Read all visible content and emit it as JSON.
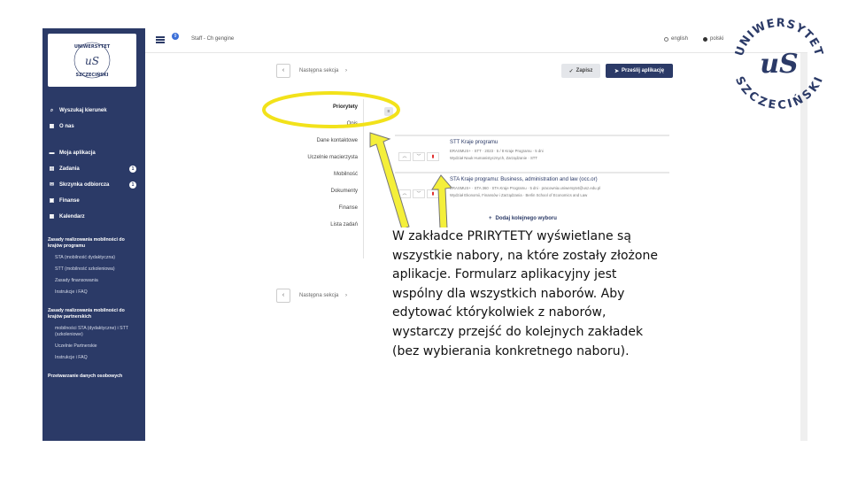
{
  "topbar": {
    "title": "Staff - Ch gengine",
    "badge": "9",
    "lang_en": "english",
    "lang_pl": "polski"
  },
  "sidebar": {
    "logo_text": "UNIWERSYTET SZCZECIŃSKI",
    "items": [
      {
        "icon": "search-icon",
        "label": "Wyszukaj kierunek",
        "badge": ""
      },
      {
        "icon": "bank-icon",
        "label": "O nas",
        "badge": ""
      },
      {
        "icon": "folder-icon",
        "label": "Moja aplikacja",
        "badge": ""
      },
      {
        "icon": "clipboard-icon",
        "label": "Zadania",
        "badge": "1"
      },
      {
        "icon": "mail-icon",
        "label": "Skrzynka odbiorcza",
        "badge": "1"
      },
      {
        "icon": "finance-icon",
        "label": "Finanse",
        "badge": ""
      },
      {
        "icon": "calendar-icon",
        "label": "Kalendarz",
        "badge": ""
      }
    ],
    "section1_title": "Zasady realizowania mobilności do krajów programu",
    "section1_items": [
      "STA (mobilność dydaktyczna)",
      "STT (mobilność szkoleniowa)",
      "Zasady finansowania",
      "Instrukcje i FAQ"
    ],
    "section2_title": "Zasady realizowania mobilności do krajów partnerskich",
    "section2_items": [
      "mobilności STA (dydaktyczne) i STT (szkoleniowe)",
      "Uczelnie Partnerskie",
      "Instrukcje i FAQ"
    ],
    "section3_title": "Przetwarzanie danych osobowych"
  },
  "main": {
    "prev_section": "Następna sekcja",
    "save_label": "Zapisz",
    "send_label": "Prześlij aplikację",
    "tabs": [
      "Priorytety",
      "Opis",
      "Dane kontaktowe",
      "Uczelnie macierzysta",
      "Mobilność",
      "Dokumenty",
      "Finanse",
      "Lista zadań"
    ],
    "collapse_label": "≡",
    "cards": [
      {
        "title": "STT Kraje programu",
        "meta1": "ERASMUS+ · STT · 2023 · 5 / 8 Kraje Programu · 5 dni",
        "meta2": "Wydział Nauk Humanistycznych, Zarządzanie · STT"
      },
      {
        "title": "STA Kraje programu: Business, administration and law (occ.or)",
        "meta1": "ERASMUS+ · STA 360 · STA Kraje Programu · 5 dni · pracownia.uniwersytet@usz.edu.pl",
        "meta2": "Wydział Ekonomii, Finansów i Zarządzania · Berlin School of Economics and Law"
      }
    ],
    "add_more": "Dodaj kolejnego wyboru",
    "next_section": "Następna sekcja"
  },
  "caption": {
    "lines": [
      "W zakładce PRIRYTETY wyświetlane są",
      "wszystkie nabory, na które zostały złożone",
      "aplikacje. Formularz aplikacyjny jest",
      "wspólny dla wszystkich naborów. Aby",
      "edytować którykolwiek z naborów,",
      "wystarczy przejść do kolejnych zakładek",
      "(bez wybierania konkretnego naboru)."
    ]
  },
  "logo": {
    "top_text": "UNIWERSYTET",
    "bottom_text": "SZCZECIŃSKI",
    "monogram": "uS"
  },
  "colors": {
    "navy": "#2b3a67",
    "highlight": "#f2e21a",
    "arrow_fill": "#f4ef3a"
  }
}
